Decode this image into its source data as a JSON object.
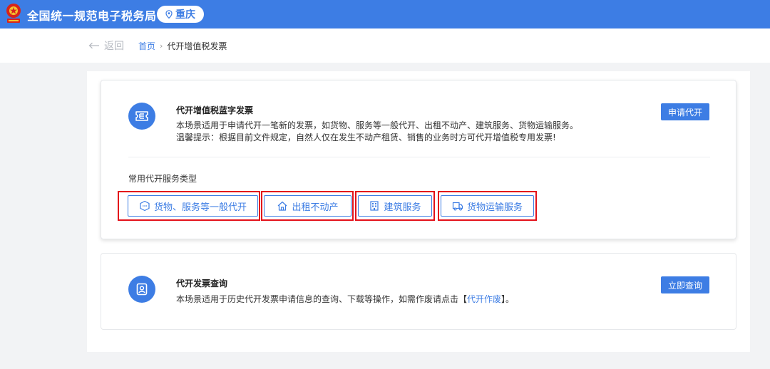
{
  "header": {
    "site_title": "全国统一规范电子税务局",
    "region": "重庆",
    "emblem_icon": "tax-emblem-icon",
    "brand_color": "#3d7de4"
  },
  "nav": {
    "back_label": "返回",
    "breadcrumb_home": "首页",
    "breadcrumb_separator": "›",
    "breadcrumb_current": "代开增值税发票"
  },
  "invoice_card": {
    "title": "代开增值税蓝字发票",
    "description": "本场景适用于申请代开一笔新的发票，如货物、服务等一般代开、出租不动产、建筑服务、货物运输服务。",
    "notice": "温馨提示：根据目前文件规定，自然人仅在发生不动产租赁、销售的业务时方可代开增值税专用发票!",
    "apply_button": "申请代开",
    "section_label": "常用代开服务类型",
    "services": [
      {
        "label": "货物、服务等一般代开",
        "icon": "goods-box-icon"
      },
      {
        "label": "出租不动产",
        "icon": "house-icon"
      },
      {
        "label": "建筑服务",
        "icon": "building-icon"
      },
      {
        "label": "货物运输服务",
        "icon": "truck-icon"
      }
    ],
    "highlight_color": "#e3111a"
  },
  "query_card": {
    "title": "代开发票查询",
    "description_prefix": "本场景适用于历史代开发票申请信息的查询、下载等操作，如需作废请点击【",
    "description_link": "代开作废",
    "description_suffix": "】。",
    "query_button": "立即查询"
  }
}
